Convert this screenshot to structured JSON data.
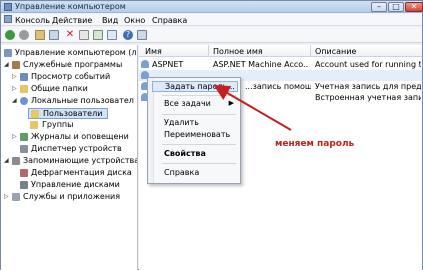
{
  "window": {
    "title": "Управление компьютером"
  },
  "title_buttons": {
    "minimize": "–",
    "maximize": "□",
    "close": "✕"
  },
  "menu": [
    {
      "label": "Консоль"
    },
    {
      "label": "Действие"
    },
    {
      "label": "Вид"
    },
    {
      "label": "Окно"
    },
    {
      "label": "Справка"
    }
  ],
  "tree": [
    {
      "label": "Управление компьютером (ло",
      "icon": "computer-icon"
    },
    {
      "label": "Служебные программы",
      "icon": "tools-icon"
    },
    {
      "label": "Просмотр событий",
      "icon": "event-viewer-icon"
    },
    {
      "label": "Общие папки",
      "icon": "folder-icon"
    },
    {
      "label": "Локальные пользовател",
      "icon": "users-icon"
    },
    {
      "label": "Пользователи",
      "icon": "folder-icon"
    },
    {
      "label": "Группы",
      "icon": "folder-icon"
    },
    {
      "label": "Журналы и оповещени",
      "icon": "logs-icon"
    },
    {
      "label": "Диспетчер устройств",
      "icon": "device-manager-icon"
    },
    {
      "label": "Запоминающие устройства",
      "icon": "storage-icon"
    },
    {
      "label": "Дефрагментация диска",
      "icon": "defrag-icon"
    },
    {
      "label": "Управление дисками",
      "icon": "disk-icon"
    },
    {
      "label": "Службы и приложения",
      "icon": "services-icon"
    }
  ],
  "list": {
    "columns": [
      "Имя",
      "Полное имя",
      "Описание"
    ],
    "rows": [
      {
        "name": "ASPNET",
        "full": "ASP.NET Machine Acco...",
        "desc": "Account used for running the A"
      },
      {
        "name": "",
        "full": "",
        "desc": ""
      },
      {
        "name": "",
        "full": "...запись помощ...",
        "desc": "Учетная запись для предостав..."
      },
      {
        "name": "",
        "full": "",
        "desc": "Встроенная учетная запись д..."
      }
    ]
  },
  "context_menu": {
    "items": [
      {
        "label": "Задать пароль..."
      },
      {
        "label": "Все задачи",
        "arrow": "▶"
      },
      {
        "label": "Удалить"
      },
      {
        "label": "Переименовать"
      },
      {
        "label": "Свойства"
      },
      {
        "label": "Справка"
      }
    ]
  },
  "annotation": {
    "text": "меняем пароль",
    "color": "#c32020"
  }
}
